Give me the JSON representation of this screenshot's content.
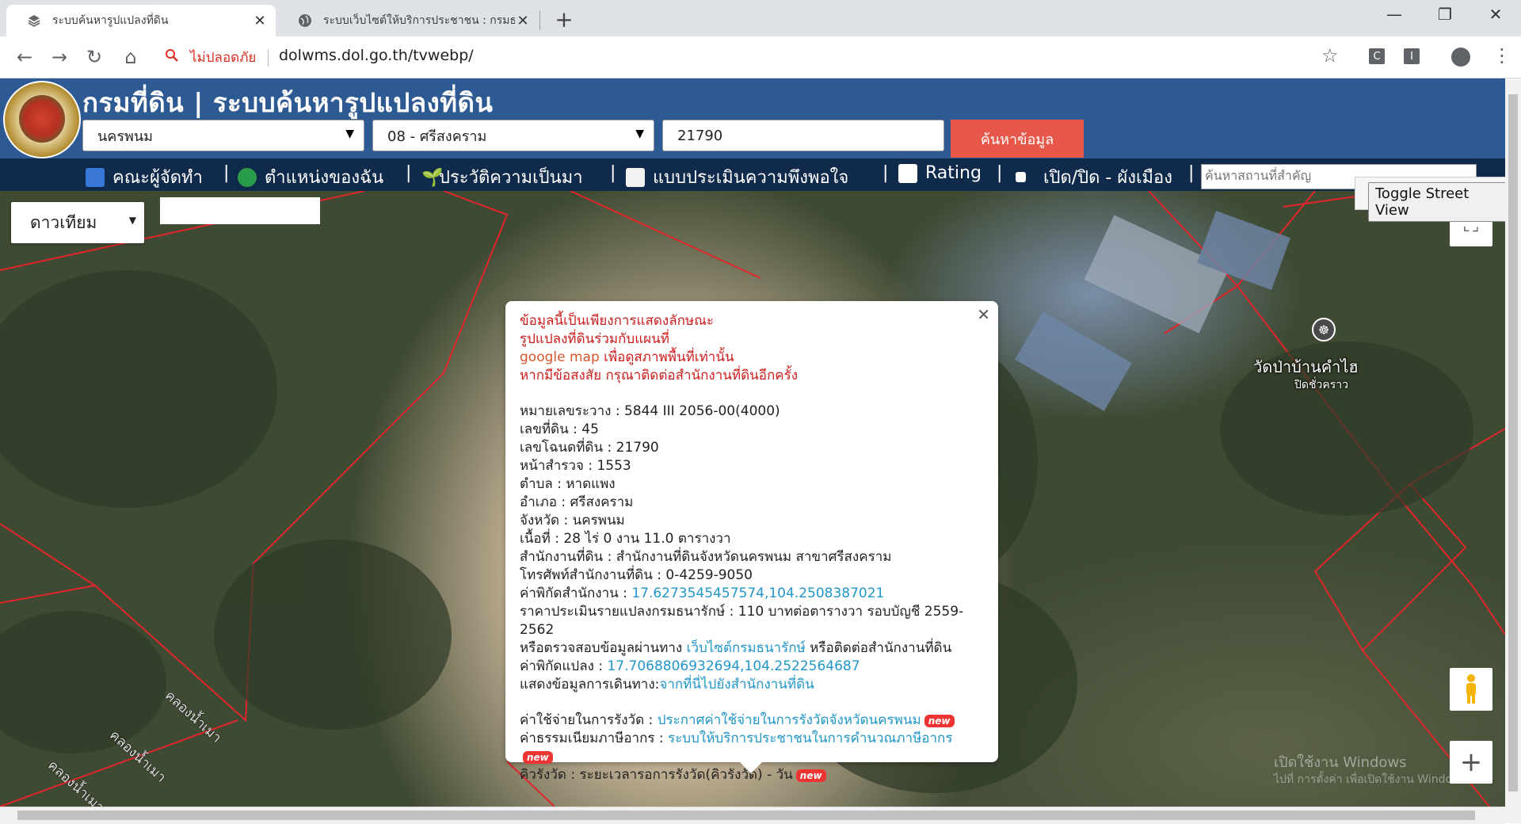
{
  "browser": {
    "tabs": [
      {
        "title": "ระบบค้นหารูปแปลงที่ดิน",
        "active": true
      },
      {
        "title": "ระบบเว็บไซต์ให้บริการประชาชน : กรมธนารักษ์",
        "active": false
      }
    ],
    "security_label": "ไม่ปลอดภัย",
    "url": "dolwms.dol.go.th/tvwebp/"
  },
  "header": {
    "title": "กรมที่ดิน | ระบบค้นหารูปแปลงที่ดิน",
    "province": "นครพนม",
    "district": "08 - ศรีสงคราม",
    "deed_number": "21790",
    "search_button": "ค้นหาข้อมูล"
  },
  "menu": {
    "items": [
      "คณะผู้จัดทำ",
      "ตำแหน่งของฉัน",
      "ประวัติความเป็นมา",
      "แบบประเมินความพึงพอใจ",
      "Rating",
      "เปิด/ปิด - ผังเมือง"
    ],
    "place_search_placeholder": "ค้นหาสถานที่สำคัญ",
    "toggle_street_view": "Toggle Street View"
  },
  "map": {
    "type_label": "ดาวเทียม",
    "poi_name": "วัดป่าบ้านคำไฮ",
    "poi_sub": "ปิดชั่วคราว",
    "canal_label": "คลองน้ำเมา",
    "watermark_line1": "เปิดใช้งาน Windows",
    "watermark_line2": "ไปที่ การตั้งค่า เพื่อเปิดใช้งาน Windows"
  },
  "info": {
    "disclaimer": [
      "ข้อมูลนี้เป็นเพียงการแสดงลักษณะ",
      "รูปแปลงที่ดินร่วมกับแผนที่",
      "google map",
      "เพื่อดูสภาพพื้นที่เท่านั้น",
      "หากมีข้อสงสัย กรุณาติดต่อสำนักงานที่ดินอีกครั้ง"
    ],
    "rows": [
      {
        "label": "หมายเลขระวาง",
        "value": "5844 III 2056-00(4000)"
      },
      {
        "label": "เลขที่ดิน",
        "value": "45"
      },
      {
        "label": "เลขโฉนดที่ดิน",
        "value": "21790"
      },
      {
        "label": "หน้าสำรวจ",
        "value": "1553"
      },
      {
        "label": "ตำบล",
        "value": "หาดแพง"
      },
      {
        "label": "อำเภอ",
        "value": "ศรีสงคราม"
      },
      {
        "label": "จังหวัด",
        "value": "นครพนม"
      },
      {
        "label": "เนื้อที่",
        "value": "28 ไร่ 0 งาน 11.0 ตารางวา"
      },
      {
        "label": "สำนักงานที่ดิน",
        "value": "สำนักงานที่ดินจังหวัดนครพนม สาขาศรีสงคราม"
      },
      {
        "label": "โทรศัพท์สำนักงานที่ดิน",
        "value": "0-4259-9050"
      }
    ],
    "office_coord_label": "ค่าพิกัดสำนักงาน",
    "office_coord": "17.6273545457574,104.2508387021",
    "price_label": "ราคาประเมินรายแปลงกรมธนารักษ์",
    "price_value": "110 บาทต่อตารางวา รอบบัญชี 2559-2562",
    "check_prefix": "หรือตรวจสอบข้อมูลผ่านทาง",
    "check_link": "เว็บไซต์กรมธนารักษ์",
    "check_suffix": "หรือติดต่อสำนักงานที่ดิน",
    "parcel_coord_label": "ค่าพิกัดแปลง",
    "parcel_coord": "17.7068806932694,104.2522564687",
    "route_label": "แสดงข้อมูลการเดินทาง:",
    "route_link": "จากที่นี่ไปยังสำนักงานที่ดิน",
    "fee_label": "ค่าใช้จ่ายในการรังวัด",
    "fee_link": "ประกาศค่าใช้จ่ายในการรังวัดจังหวัดนครพนม",
    "tax_label": "ค่าธรรมเนียมภาษีอากร",
    "tax_link": "ระบบให้บริการประชาชนในการคำนวณภาษีอากร",
    "queue_label": "คิวรังวัด",
    "queue_value": "ระยะเวลารอการรังวัด(คิวรังวัด) - วัน",
    "new_badge": "new"
  }
}
